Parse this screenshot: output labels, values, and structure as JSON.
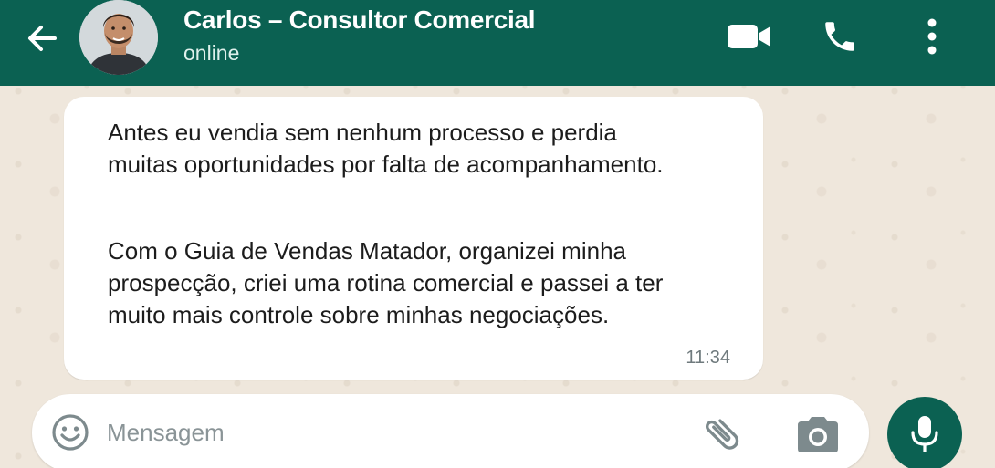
{
  "header": {
    "contact_name": "Carlos – Consultor Comercial",
    "status": "online",
    "icons": {
      "back": "arrow-left-icon",
      "video": "video-camera-icon",
      "call": "phone-icon",
      "menu": "more-vertical-icon"
    },
    "colors": {
      "bar": "#0b6152",
      "text": "#ffffff"
    }
  },
  "message": {
    "paragraphs": [
      "Antes eu vendia sem nenhum processo e perdia muitas oportunidades por falta de acompanhamento.",
      "Com o Guia de Vendas Matador, organizei minha prospecção, criei uma rotina comercial e passei a ter muito mais controle sobre minhas negociações."
    ],
    "time": "11:34"
  },
  "composer": {
    "placeholder": "Mensagem",
    "value": "",
    "icons": {
      "emoji": "emoji-icon",
      "attach": "paperclip-icon",
      "camera": "camera-icon",
      "mic": "microphone-icon"
    },
    "colors": {
      "mic_bg": "#0b6152"
    }
  }
}
